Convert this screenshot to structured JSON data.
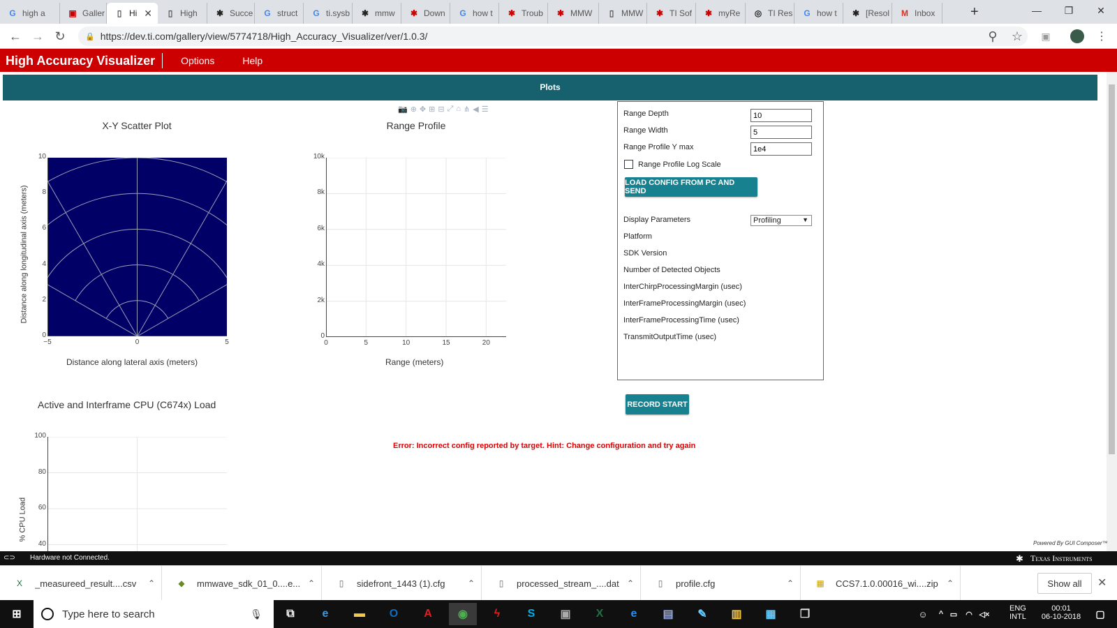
{
  "browser": {
    "tabs": [
      {
        "title": "high a",
        "icon": "G",
        "color": "#4285f4"
      },
      {
        "title": "Galler",
        "icon": "▣",
        "color": "#cc0000"
      },
      {
        "title": "Hi",
        "icon": "▯",
        "color": "#555"
      },
      {
        "title": "High",
        "icon": "▯",
        "color": "#555"
      },
      {
        "title": "Succe",
        "icon": "✱",
        "color": "#222"
      },
      {
        "title": "struct",
        "icon": "G",
        "color": "#4285f4"
      },
      {
        "title": "ti.sysb",
        "icon": "G",
        "color": "#4285f4"
      },
      {
        "title": "mmw",
        "icon": "✱",
        "color": "#222"
      },
      {
        "title": "Down",
        "icon": "✱",
        "color": "#cc0000"
      },
      {
        "title": "how t",
        "icon": "G",
        "color": "#4285f4"
      },
      {
        "title": "Troub",
        "icon": "✱",
        "color": "#cc0000"
      },
      {
        "title": "MMW",
        "icon": "✱",
        "color": "#cc0000"
      },
      {
        "title": "MMW",
        "icon": "▯",
        "color": "#555"
      },
      {
        "title": "TI Sof",
        "icon": "✱",
        "color": "#cc0000"
      },
      {
        "title": "myRe",
        "icon": "✱",
        "color": "#cc0000"
      },
      {
        "title": "TI Res",
        "icon": "◎",
        "color": "#222"
      },
      {
        "title": "how t",
        "icon": "G",
        "color": "#4285f4"
      },
      {
        "title": "[Resol",
        "icon": "✱",
        "color": "#222"
      },
      {
        "title": "Inbox",
        "icon": "M",
        "color": "#d93025"
      }
    ],
    "url": "https://dev.ti.com/gallery/view/5774718/High_Accuracy_Visualizer/ver/1.0.3/"
  },
  "app": {
    "title": "High Accuracy Visualizer",
    "menu": [
      "Options",
      "Help"
    ],
    "plots_tab": "Plots"
  },
  "scatter": {
    "title": "X-Y Scatter Plot",
    "xlabel": "Distance along lateral axis (meters)",
    "ylabel": "Distance along longitudinal axis (meters)",
    "xticks": [
      "−5",
      "0",
      "5"
    ],
    "yticks": [
      "0",
      "2",
      "4",
      "6",
      "8",
      "10"
    ],
    "bg": "#000066"
  },
  "range": {
    "title": "Range Profile",
    "xlabel": "Range (meters)",
    "xticks": [
      "0",
      "5",
      "10",
      "15",
      "20"
    ],
    "yticks": [
      "0",
      "2k",
      "4k",
      "6k",
      "8k",
      "10k"
    ]
  },
  "cpu": {
    "title": "Active and Interframe  CPU (C674x) Load",
    "ylabel": "% CPU Load",
    "yticks": [
      "40",
      "60",
      "80",
      "100"
    ]
  },
  "chart_data": [
    {
      "type": "scatter",
      "title": "X-Y Scatter Plot",
      "xlabel": "Distance along lateral axis (meters)",
      "ylabel": "Distance along longitudinal axis (meters)",
      "xlim": [
        -5,
        5
      ],
      "ylim": [
        0,
        10
      ],
      "series": []
    },
    {
      "type": "line",
      "title": "Range Profile",
      "xlabel": "Range (meters)",
      "ylabel": "",
      "xlim": [
        0,
        22.5
      ],
      "ylim": [
        0,
        10000
      ],
      "series": []
    },
    {
      "type": "line",
      "title": "Active and Interframe  CPU (C674x) Load",
      "xlabel": "",
      "ylabel": "% CPU Load",
      "ylim": [
        0,
        100
      ],
      "series": []
    }
  ],
  "panel": {
    "range_depth_label": "Range Depth",
    "range_depth": "10",
    "range_width_label": "Range Width",
    "range_width": "5",
    "ymax_label": "Range Profile Y max",
    "ymax": "1e4",
    "logscale_label": "Range Profile Log Scale",
    "load_btn": "LOAD CONFIG FROM PC AND SEND",
    "display_label": "Display Parameters",
    "display_value": "Profiling",
    "params": [
      "Platform",
      "SDK Version",
      "Number of Detected Objects",
      "InterChirpProcessingMargin (usec)",
      "InterFrameProcessingMargin (usec)",
      "InterFrameProcessingTime (usec)",
      "TransmitOutputTime (usec)"
    ]
  },
  "record_btn": "RECORD START",
  "error": "Error: Incorrect config reported by target. Hint: Change configuration and try again",
  "powered": "Powered By GUI Composer™",
  "status": {
    "text": "Hardware not Connected.",
    "brand": "Texas Instruments"
  },
  "downloads": [
    {
      "name": "_measureed_result....csv",
      "icon": "X",
      "color": "#1e7145"
    },
    {
      "name": "mmwave_sdk_01_0....e...",
      "icon": "◆",
      "color": "#6a8a2a"
    },
    {
      "name": "sidefront_1443 (1).cfg",
      "icon": "▯",
      "color": "#666"
    },
    {
      "name": "processed_stream_....dat",
      "icon": "▯",
      "color": "#666"
    },
    {
      "name": "profile.cfg",
      "icon": "▯",
      "color": "#666"
    },
    {
      "name": "CCS7.1.0.00016_wi....zip",
      "icon": "▦",
      "color": "#c8a000"
    }
  ],
  "show_all": "Show all",
  "taskbar": {
    "search_placeholder": "Type here to search",
    "apps": [
      {
        "name": "task-view",
        "glyph": "⧉",
        "color": "#fff"
      },
      {
        "name": "edge",
        "glyph": "e",
        "color": "#3b9ae1"
      },
      {
        "name": "explorer",
        "glyph": "▬",
        "color": "#f2c94c"
      },
      {
        "name": "outlook",
        "glyph": "O",
        "color": "#0f6cbd"
      },
      {
        "name": "acrobat",
        "glyph": "A",
        "color": "#e02020"
      },
      {
        "name": "chrome",
        "glyph": "◉",
        "color": "#4caf50"
      },
      {
        "name": "flash",
        "glyph": "ϟ",
        "color": "#e02020"
      },
      {
        "name": "skype",
        "glyph": "S",
        "color": "#00aff0"
      },
      {
        "name": "app-gray",
        "glyph": "▣",
        "color": "#aaa"
      },
      {
        "name": "excel",
        "glyph": "X",
        "color": "#1e7145"
      },
      {
        "name": "ie",
        "glyph": "e",
        "color": "#1e90ff"
      },
      {
        "name": "notepad",
        "glyph": "▤",
        "color": "#9ad"
      },
      {
        "name": "paint",
        "glyph": "✎",
        "color": "#6cf"
      },
      {
        "name": "notes",
        "glyph": "▥",
        "color": "#f2c94c"
      },
      {
        "name": "photos",
        "glyph": "▦",
        "color": "#6cf"
      },
      {
        "name": "cube",
        "glyph": "❒",
        "color": "#ddd"
      }
    ],
    "lang": "ENG",
    "layout": "INTL",
    "time": "00:01",
    "date": "06-10-2018"
  }
}
